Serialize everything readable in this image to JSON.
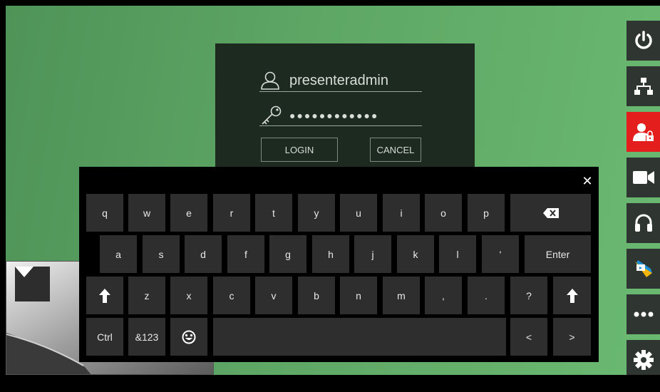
{
  "login": {
    "username": "presenteradmin",
    "password_mask": "●●●●●●●●●●●●",
    "login_label": "LOGIN",
    "cancel_label": "CANCEL"
  },
  "keyboard": {
    "close_label": "✕",
    "row1": [
      "q",
      "w",
      "e",
      "r",
      "t",
      "y",
      "u",
      "i",
      "o",
      "p"
    ],
    "row2": [
      "a",
      "s",
      "d",
      "f",
      "g",
      "h",
      "j",
      "k",
      "l",
      "'"
    ],
    "enter_label": "Enter",
    "row3": [
      "z",
      "x",
      "c",
      "v",
      "b",
      "n",
      "m",
      ",",
      ".",
      "?"
    ],
    "ctrl_label": "Ctrl",
    "sym_label": "&123",
    "left_label": "<",
    "right_label": ">"
  },
  "sidebar": {
    "items": [
      {
        "icon": "power-icon"
      },
      {
        "icon": "network-icon"
      },
      {
        "icon": "user-lock-icon",
        "active": true
      },
      {
        "icon": "camera-icon"
      },
      {
        "icon": "headset-icon"
      },
      {
        "icon": "presentation-icon"
      },
      {
        "icon": "more-icon"
      },
      {
        "icon": "settings-icon"
      }
    ],
    "active_color": "#e41d1d"
  }
}
